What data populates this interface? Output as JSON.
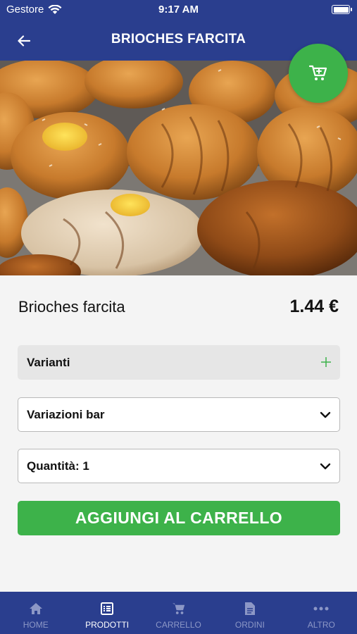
{
  "status_bar": {
    "carrier": "Gestore",
    "time": "9:17 AM"
  },
  "nav": {
    "title": "BRIOCHES FARCITA",
    "back_icon": "arrow-left-icon"
  },
  "hero": {
    "alt_icon": "product-photo"
  },
  "cart_fab": {
    "icon": "cart-icon",
    "color": "#3db24a"
  },
  "product": {
    "name": "Brioches farcita",
    "price": "1.44 €"
  },
  "variants": {
    "label": "Varianti",
    "icon": "plus-icon"
  },
  "selects": {
    "bar": {
      "label": "Variazioni bar"
    },
    "quantity": {
      "label": "Quantità: 1"
    }
  },
  "add_button": {
    "label": "AGGIUNGI AL CARRELLO"
  },
  "tabs": [
    {
      "label": "HOME",
      "icon": "home-icon",
      "active": false
    },
    {
      "label": "PRODOTTI",
      "icon": "list-icon",
      "active": true
    },
    {
      "label": "CARRELLO",
      "icon": "cart-icon",
      "active": false
    },
    {
      "label": "ORDINI",
      "icon": "document-icon",
      "active": false
    },
    {
      "label": "ALTRO",
      "icon": "more-icon",
      "active": false
    }
  ],
  "colors": {
    "primary": "#2a3e8e",
    "accent": "#3db24a",
    "tab_inactive": "#8c97c6"
  }
}
